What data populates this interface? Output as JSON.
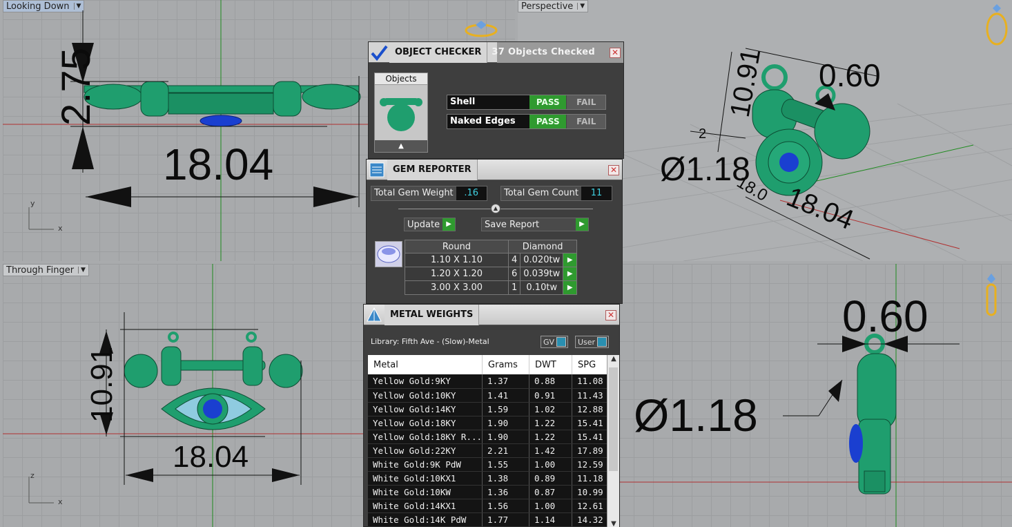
{
  "viewports": {
    "top": {
      "label": "Looking Down",
      "dims": {
        "height": "2.75",
        "width": "18.04"
      },
      "axes": {
        "v": "y",
        "h": "x"
      }
    },
    "perspective": {
      "label": "Perspective",
      "dims": {
        "height": "10.91",
        "loop": "0.60",
        "diameter": "Ø1.18",
        "width": "18.04",
        "small1": "2",
        "small2": "18.0"
      }
    },
    "front": {
      "label": "Through Finger",
      "dims": {
        "height": "10.91",
        "width": "18.04"
      },
      "axes": {
        "v": "z",
        "h": "x"
      }
    },
    "right": {
      "dims": {
        "loop": "0.60",
        "diameter": "Ø1.18"
      }
    }
  },
  "object_checker": {
    "title": "OBJECT CHECKER",
    "summary": "37 Objects Checked",
    "objects_label": "Objects",
    "checks": [
      {
        "name": "Shell",
        "pass": "PASS",
        "fail": "FAIL"
      },
      {
        "name": "Naked Edges",
        "pass": "PASS",
        "fail": "FAIL"
      }
    ]
  },
  "gem_reporter": {
    "title": "GEM REPORTER",
    "total_weight_label": "Total Gem Weight",
    "total_weight": ".16",
    "total_count_label": "Total Gem Count",
    "total_count": "11",
    "update_label": "Update",
    "save_label": "Save Report",
    "table": {
      "shape": "Round",
      "type": "Diamond",
      "rows": [
        {
          "size": "1.10 X 1.10",
          "count": "4",
          "weight": "0.020tw"
        },
        {
          "size": "1.20 X 1.20",
          "count": "6",
          "weight": "0.039tw"
        },
        {
          "size": "3.00 X 3.00",
          "count": "1",
          "weight": "0.10tw"
        }
      ]
    }
  },
  "metal_weights": {
    "title": "METAL WEIGHTS",
    "library": "Library: Fifth Ave - (Slow)-Metal",
    "toggle_gv": "GV",
    "toggle_user": "User",
    "columns": [
      "Metal",
      "Grams",
      "DWT",
      "SPG"
    ],
    "rows": [
      {
        "metal": "Yellow Gold:9KY",
        "grams": "1.37",
        "dwt": "0.88",
        "spg": "11.08"
      },
      {
        "metal": "Yellow Gold:10KY",
        "grams": "1.41",
        "dwt": "0.91",
        "spg": "11.43"
      },
      {
        "metal": "Yellow Gold:14KY",
        "grams": "1.59",
        "dwt": "1.02",
        "spg": "12.88"
      },
      {
        "metal": "Yellow Gold:18KY",
        "grams": "1.90",
        "dwt": "1.22",
        "spg": "15.41"
      },
      {
        "metal": "Yellow Gold:18KY R...",
        "grams": "1.90",
        "dwt": "1.22",
        "spg": "15.41"
      },
      {
        "metal": "Yellow Gold:22KY",
        "grams": "2.21",
        "dwt": "1.42",
        "spg": "17.89"
      },
      {
        "metal": "White Gold:9K PdW",
        "grams": "1.55",
        "dwt": "1.00",
        "spg": "12.59"
      },
      {
        "metal": "White Gold:10KX1",
        "grams": "1.38",
        "dwt": "0.89",
        "spg": "11.18"
      },
      {
        "metal": "White Gold:10KW",
        "grams": "1.36",
        "dwt": "0.87",
        "spg": "10.99"
      },
      {
        "metal": "White Gold:14KX1",
        "grams": "1.56",
        "dwt": "1.00",
        "spg": "12.61"
      },
      {
        "metal": "White Gold:14K PdW",
        "grams": "1.77",
        "dwt": "1.14",
        "spg": "14.32"
      }
    ]
  },
  "colors": {
    "model": "#1f9e6e",
    "gem": "#1a3fd0",
    "pass": "#2f9a2f",
    "accent": "#3fd0e0"
  }
}
